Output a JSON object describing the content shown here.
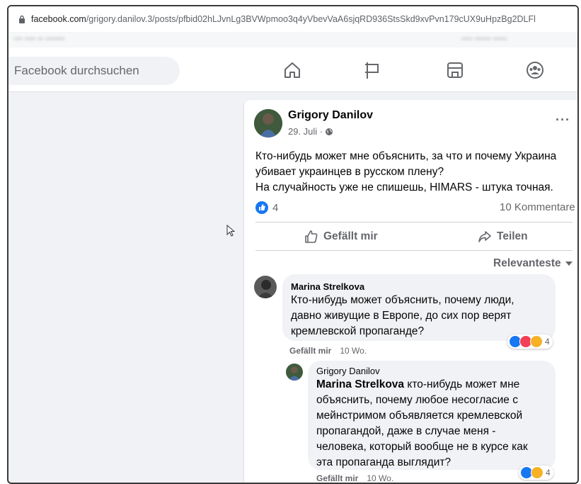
{
  "browser": {
    "url_domain": "facebook.com",
    "url_path": "/grigory.danilov.3/posts/pfbid02hLJvnLg3BVWpmoo3q4yVbevVaA6sjqRD936StsSkd9xvPvn179cUX9uHpzBg2DLFl"
  },
  "header": {
    "search_placeholder": "Facebook durchsuchen",
    "nav_icons": [
      "home-icon",
      "pages-flag-icon",
      "marketplace-icon",
      "groups-icon"
    ]
  },
  "post": {
    "author": "Grigory Danilov",
    "date": "29. Juli ·",
    "more": "···",
    "text_lines": [
      "Кто-нибудь может мне объяснить, за что и почему Украина",
      "убивает украинцев в русском плену?",
      "На случайность уже не спишешь, HIMARS -  штука точная."
    ],
    "like_count": "4",
    "comment_count": "10 Kommentare",
    "like_label": "Gefällt mir",
    "share_label": "Teilen",
    "sort_label": "Relevanteste"
  },
  "comments": [
    {
      "author": "Marina Strelkova",
      "text_lines": [
        "Кто-нибудь может объяснить, почему люди,",
        "давно живущие в Европе, до сих пор верят",
        "кремлевской пропаганде?"
      ],
      "reaction_count": "4",
      "like_label": "Gefällt mir",
      "age": "10 Wo."
    },
    {
      "author": "Grigory Danilov",
      "mention": "Marina Strelkova",
      "first_line_rest": " кто-нибудь может мне",
      "text_lines": [
        "объяснить, почему любое несогласие с",
        "мейнстримом объявляется кремлевской",
        "пропагандой, даже в случае меня -",
        "человека, который вообще не в курсе как",
        "эта пропаганда выглядит?"
      ],
      "reaction_count": "4",
      "like_label": "Gefällt mir",
      "age": "10 Wo."
    }
  ],
  "colors": {
    "like_blue": "#1877f2",
    "love_red": "#f33e58",
    "haha_yellow": "#f7b125",
    "secondary_text": "#65676b"
  }
}
